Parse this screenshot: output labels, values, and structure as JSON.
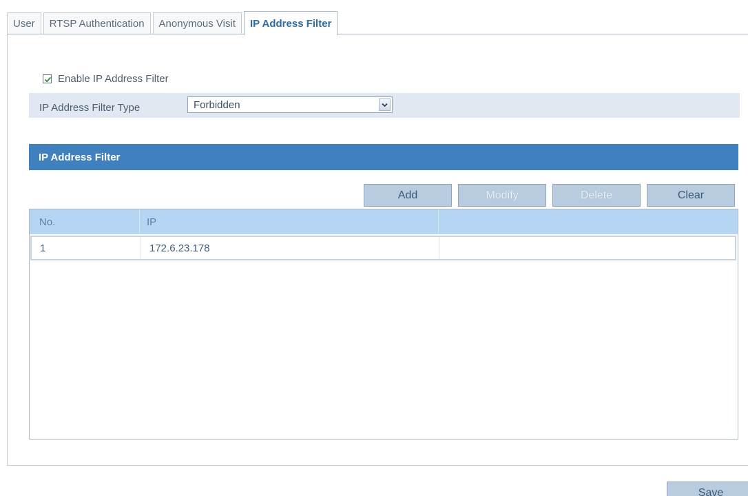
{
  "tabs": [
    {
      "label": "User",
      "active": false
    },
    {
      "label": "RTSP Authentication",
      "active": false
    },
    {
      "label": "Anonymous Visit",
      "active": false
    },
    {
      "label": "IP Address Filter",
      "active": true
    }
  ],
  "enable_filter": {
    "label": "Enable IP Address Filter",
    "checked": true
  },
  "filter_type": {
    "label": "IP Address Filter Type",
    "selected": "Forbidden"
  },
  "section": {
    "title": "IP Address Filter"
  },
  "buttons": {
    "add": "Add",
    "modify": "Modify",
    "delete": "Delete",
    "clear": "Clear",
    "save": "Save"
  },
  "table": {
    "headers": [
      "No.",
      "IP",
      ""
    ],
    "rows": [
      {
        "no": "1",
        "ip": "172.6.23.178"
      }
    ]
  },
  "colors": {
    "accent": "#4080bf",
    "header_row": "#b6d5f2",
    "filter_row_bg": "#e1e8f1",
    "active_tab_text": "#2c6ca3",
    "button_bg": "#b9ccdf"
  }
}
